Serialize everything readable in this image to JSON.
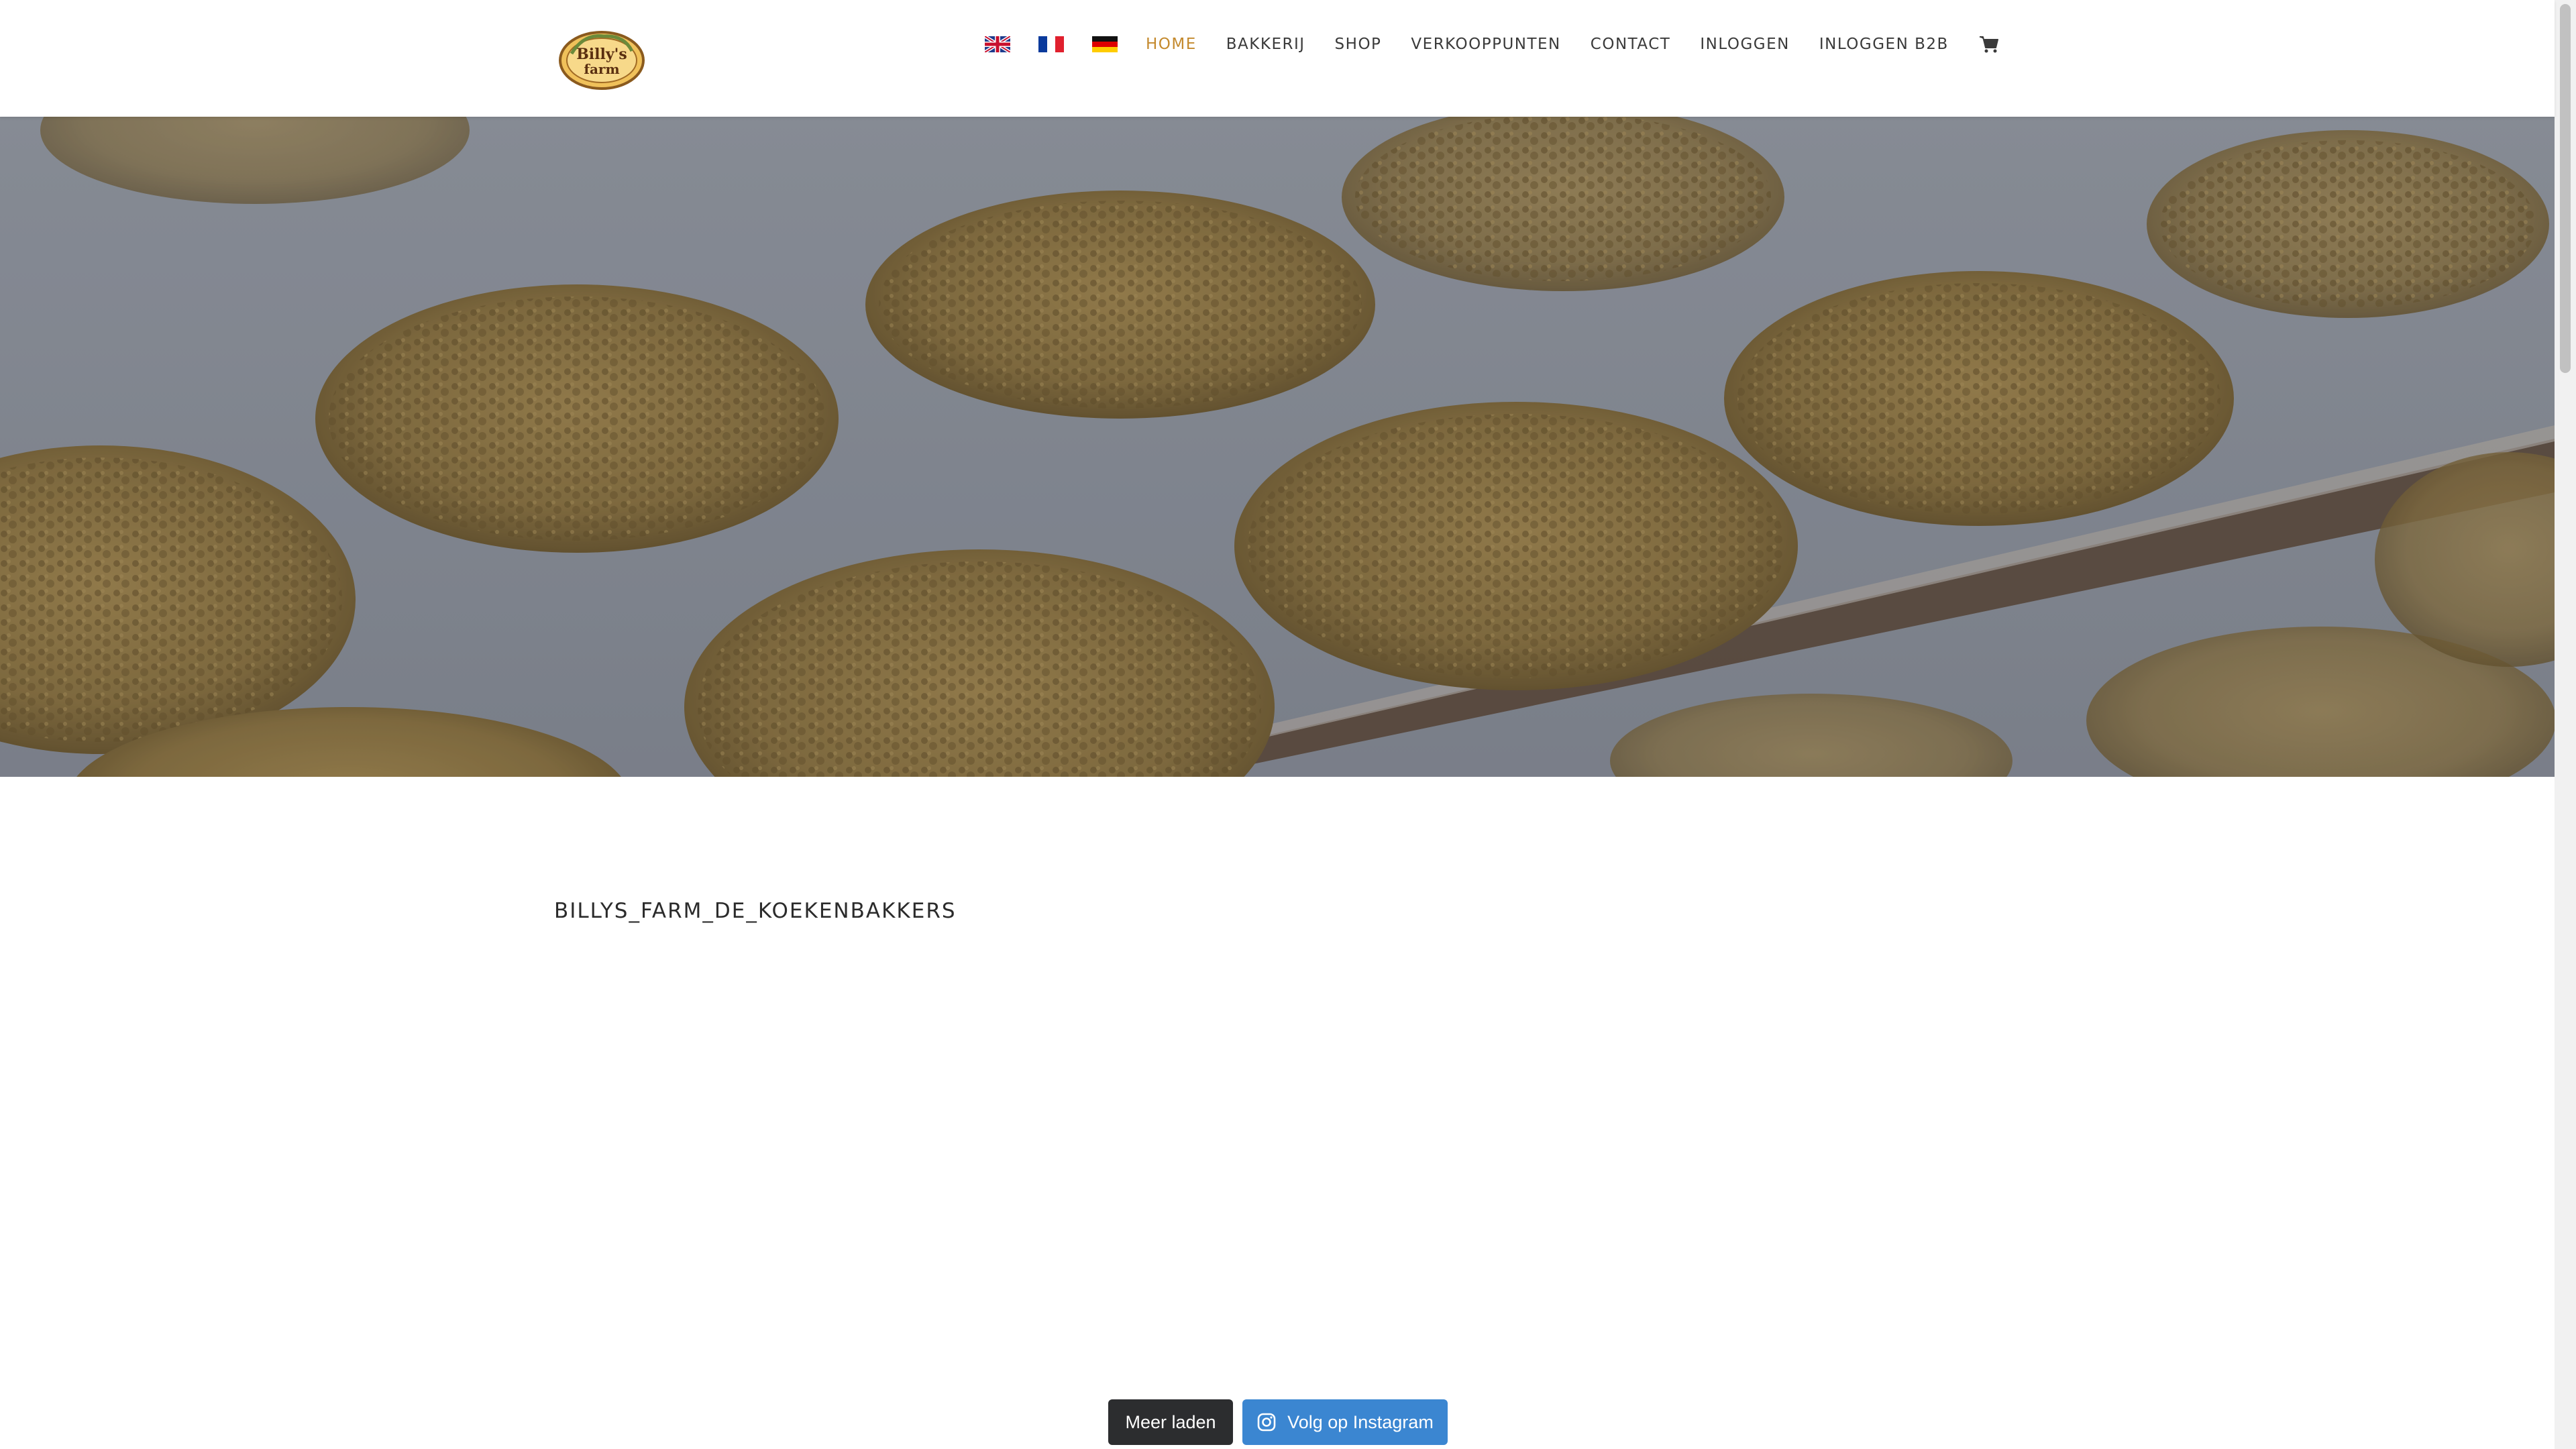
{
  "header": {
    "logo_text": "Billy's farm",
    "languages": [
      {
        "name": "English",
        "icon": "uk-flag-icon"
      },
      {
        "name": "Français",
        "icon": "fr-flag-icon"
      },
      {
        "name": "Deutsch",
        "icon": "de-flag-icon"
      }
    ],
    "nav": [
      {
        "label": "HOME",
        "active": true
      },
      {
        "label": "BAKKERIJ"
      },
      {
        "label": "SHOP"
      },
      {
        "label": "VERKOOPPUNTEN"
      },
      {
        "label": "CONTACT"
      },
      {
        "label": "INLOGGEN"
      },
      {
        "label": "INLOGGEN B2B"
      }
    ],
    "cart_icon": "shopping-cart-icon"
  },
  "hero": {
    "image": "cookies-on-baking-tray"
  },
  "instagram": {
    "account": "BILLYS_FARM_DE_KOEKENBAKKERS",
    "load_more": "Meer laden",
    "follow": "Volg op Instagram"
  },
  "colors": {
    "accent": "#c48a2e",
    "load_button": "#2c2d2f",
    "follow_button": "#3b86d1"
  }
}
